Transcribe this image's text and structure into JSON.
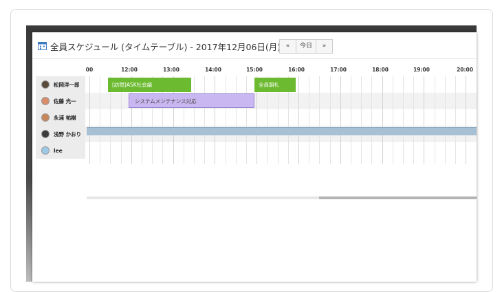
{
  "dialog": {
    "title": "全員スケジュール (タイムテーブル) - 2017年12月06日(月)",
    "nav": {
      "prev": "«",
      "today": "今日",
      "next": "»"
    }
  },
  "timetable": {
    "hours": [
      "00",
      "12:00",
      "13:00",
      "14:00",
      "15:00",
      "16:00",
      "17:00",
      "18:00",
      "19:00",
      "20:00"
    ],
    "users": [
      {
        "name": "松岡洋一郎",
        "avatar_color": "#5a4a3c"
      },
      {
        "name": "佐藤 光一",
        "avatar_color": "#d98c6a"
      },
      {
        "name": "永浦 祐樹",
        "avatar_color": "#c7865a"
      },
      {
        "name": "浅野 かおり",
        "avatar_color": "#3b3b3b"
      },
      {
        "name": "lee",
        "avatar_color": "#9cc9e6"
      }
    ],
    "events": [
      {
        "label": "[訪問]ASK社会議",
        "color": "#6cba2f"
      },
      {
        "label": "全員朝礼",
        "color": "#6cba2f"
      },
      {
        "label": "システムメンテナンス対応",
        "color": "#c8b7f0"
      }
    ]
  },
  "colors": {
    "event_green": "#6cba2f",
    "event_purple": "#c8b7f0",
    "all_day_bar": "#a8c0d4"
  }
}
